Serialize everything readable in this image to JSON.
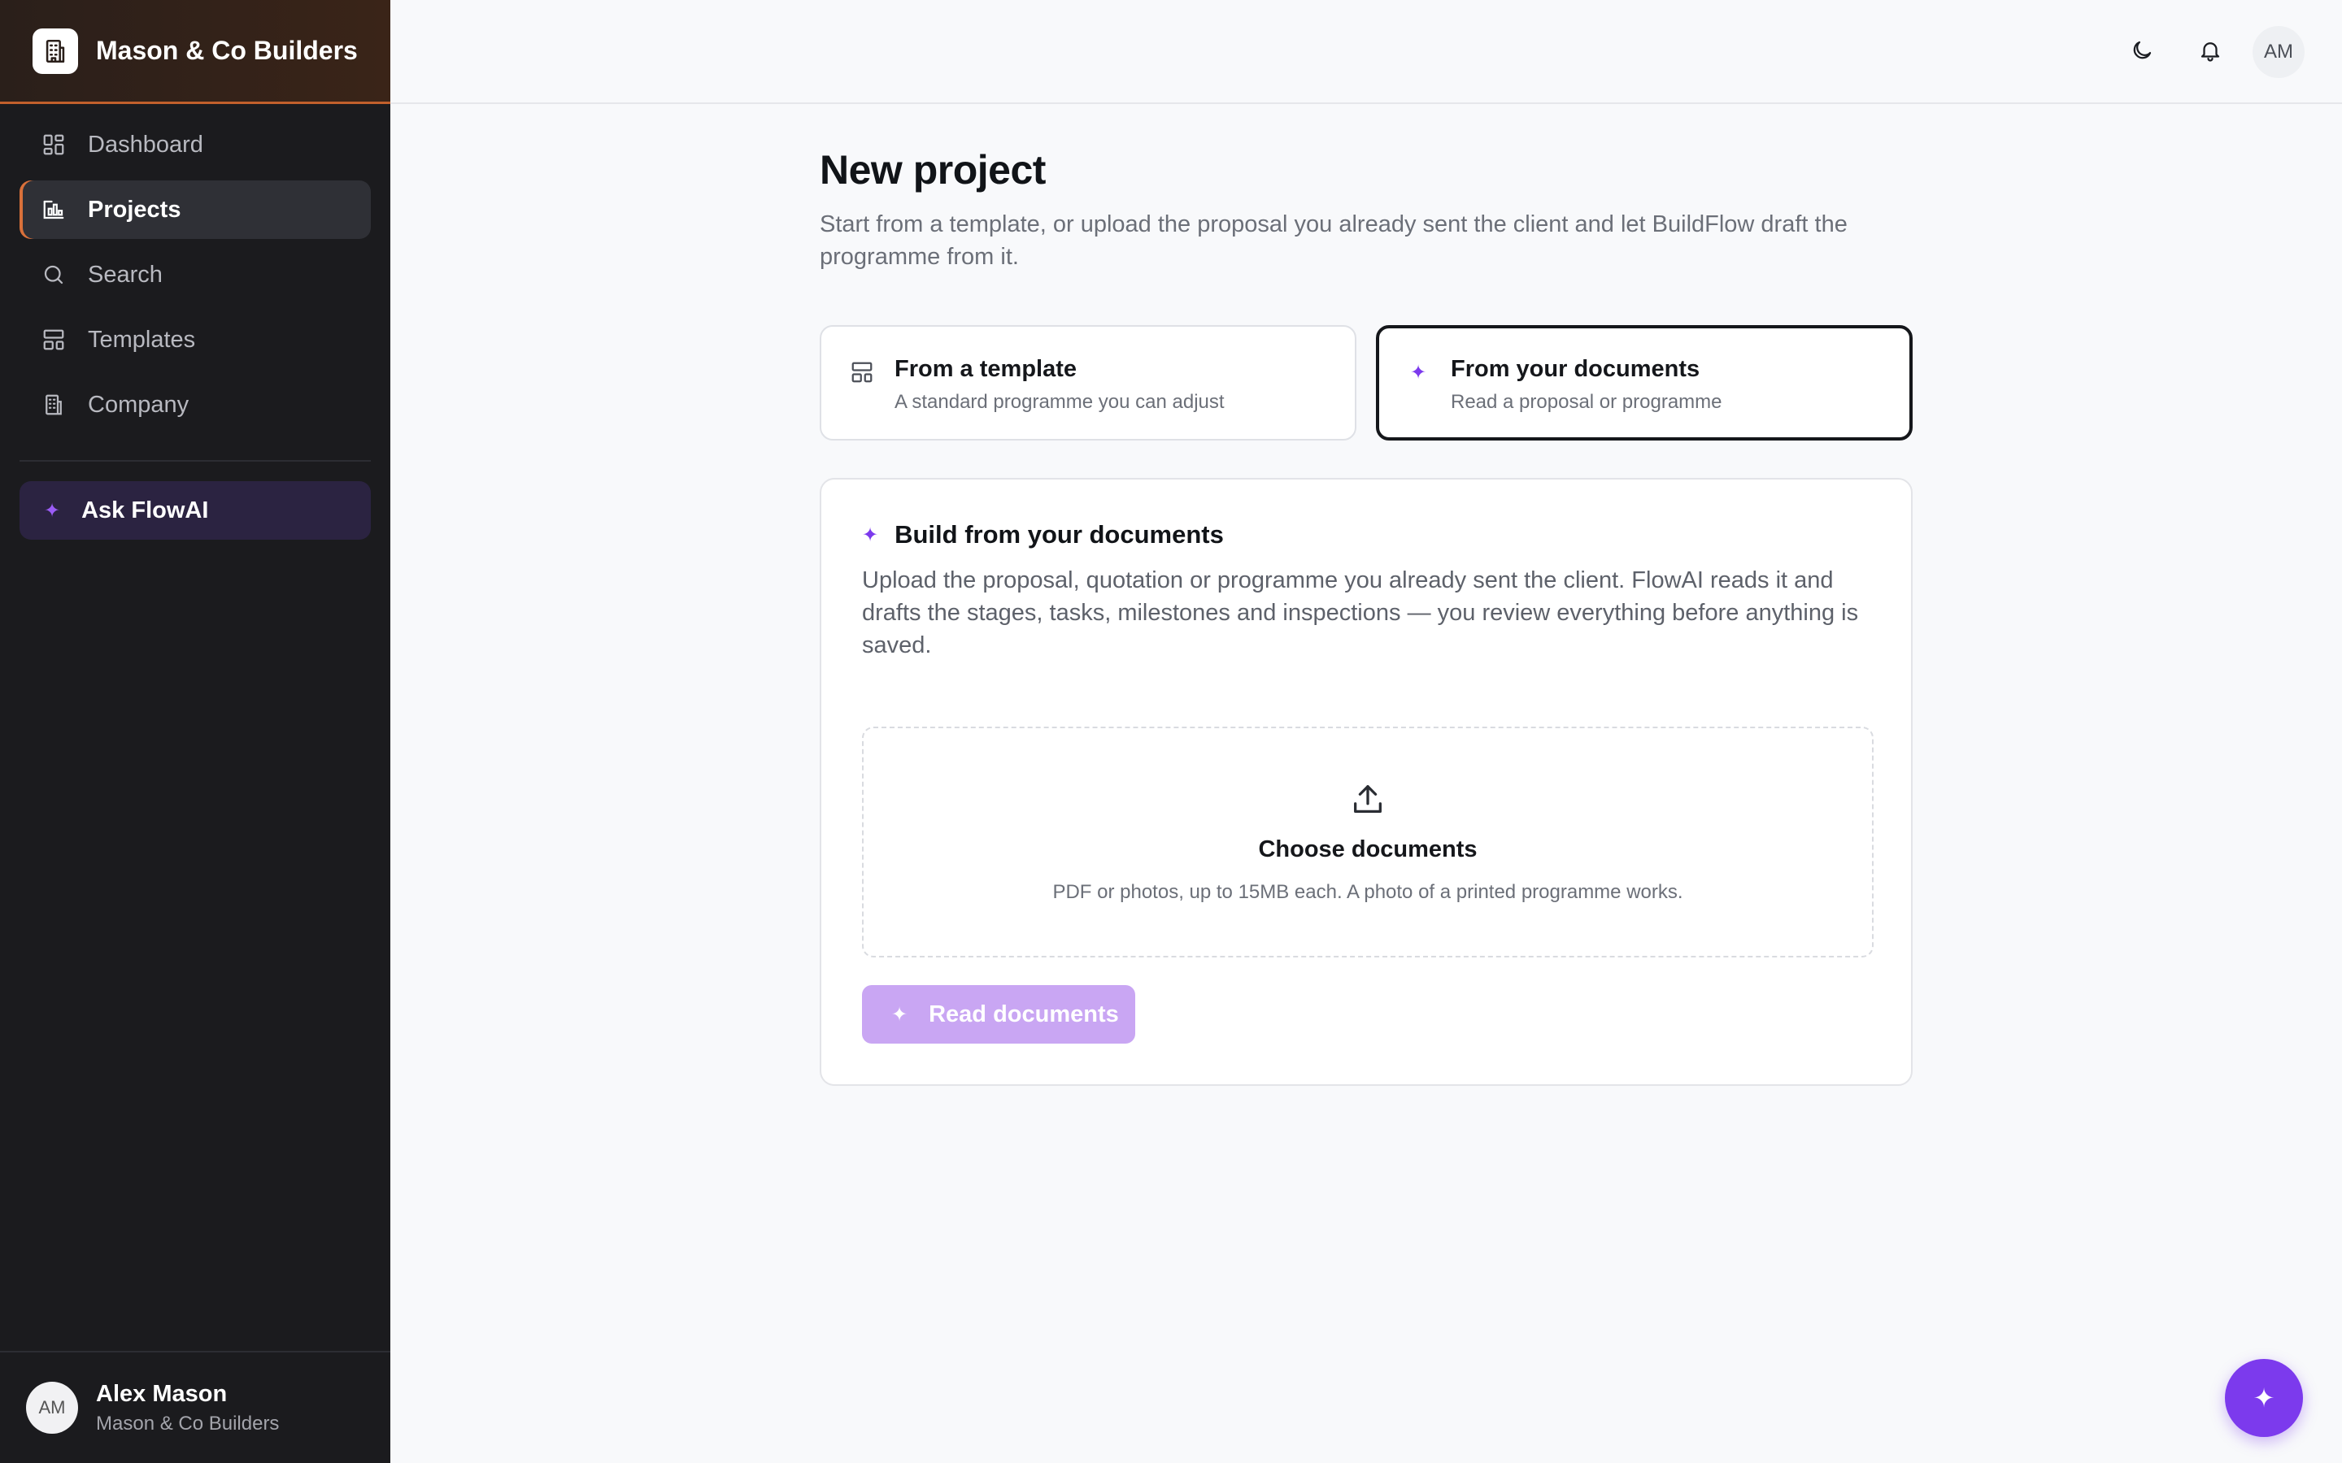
{
  "brand": {
    "name": "Mason & Co Builders",
    "logo_icon": "building-icon"
  },
  "sidebar": {
    "items": [
      {
        "label": "Dashboard",
        "icon": "dashboard-icon",
        "active": false
      },
      {
        "label": "Projects",
        "icon": "projects-icon",
        "active": true
      },
      {
        "label": "Search",
        "icon": "search-icon",
        "active": false
      },
      {
        "label": "Templates",
        "icon": "templates-icon",
        "active": false
      },
      {
        "label": "Company",
        "icon": "building-icon",
        "active": false
      }
    ],
    "ask_ai": {
      "label": "Ask FlowAI",
      "icon": "sparkle-icon"
    }
  },
  "user": {
    "initials": "AM",
    "name": "Alex Mason",
    "company": "Mason & Co Builders"
  },
  "topbar": {
    "avatar_initials": "AM",
    "icons": [
      "moon-icon",
      "bell-icon"
    ]
  },
  "page": {
    "title": "New project",
    "subtitle": "Start from a template, or upload the proposal you already sent the client and let BuildFlow draft the programme from it."
  },
  "options": [
    {
      "title": "From a template",
      "subtitle": "A standard programme you can adjust",
      "icon": "template-icon",
      "selected": false
    },
    {
      "title": "From your documents",
      "subtitle": "Read a proposal or programme",
      "icon": "sparkle-icon",
      "selected": true
    }
  ],
  "build_card": {
    "title": "Build from your documents",
    "description": "Upload the proposal, quotation or programme you already sent the client. FlowAI reads it and drafts the stages, tasks, milestones and inspections — you review everything before anything is saved.",
    "dropzone": {
      "title": "Choose documents",
      "hint": "PDF or photos, up to 15MB each. A photo of a printed programme works."
    },
    "button_label": "Read documents"
  },
  "colors": {
    "accent": "#7c3aed",
    "brand_accent": "#d9703a",
    "sidebar_bg": "#1b1b1e"
  }
}
